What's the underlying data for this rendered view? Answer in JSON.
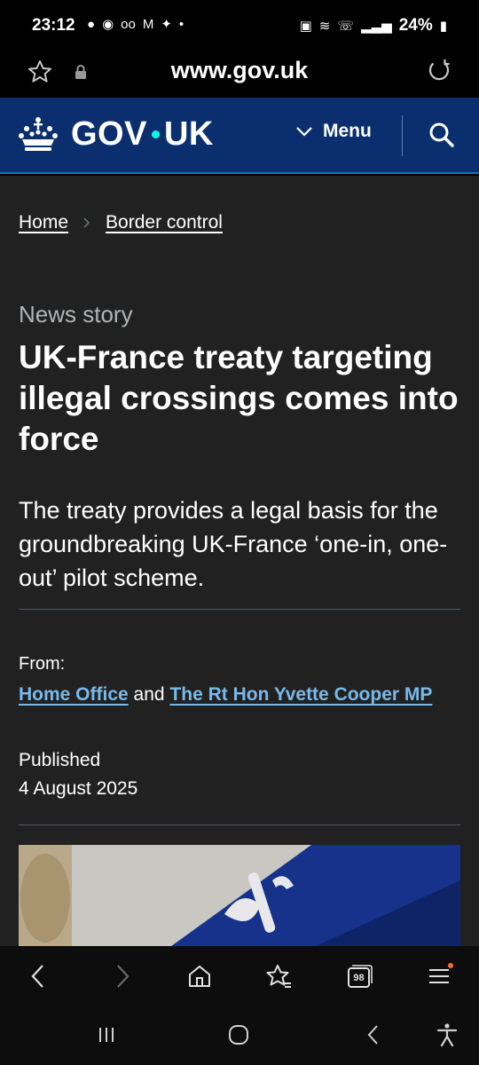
{
  "status_bar": {
    "time": "23:12",
    "battery": "24%"
  },
  "browser": {
    "url": "www.gov.uk",
    "tab_count": "98"
  },
  "header": {
    "logo_left": "GOV",
    "logo_right": "UK",
    "menu_label": "Menu",
    "accent_color": "#00ffe0",
    "background_color": "#0b2f6e"
  },
  "breadcrumb": {
    "items": [
      "Home",
      "Border control"
    ]
  },
  "article": {
    "type": "News story",
    "title": "UK-France treaty targeting illegal crossings comes into force",
    "lead": "The treaty provides a legal basis for the groundbreaking UK-France ‘one-in, one-out’ pilot scheme.",
    "from_label": "From:",
    "from_org_1": "Home Office",
    "from_and": " and ",
    "from_org_2": "The Rt Hon Yvette Cooper MP",
    "published_label": "Published",
    "published_date": "4 August 2025"
  }
}
